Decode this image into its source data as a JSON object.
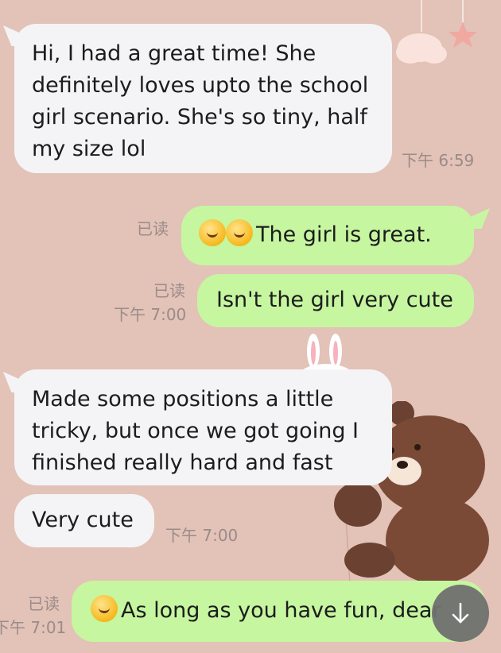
{
  "messages": [
    {
      "text": "Hi, I had a great time! She definitely loves upto the school girl scenario. She's so tiny, half my size lol",
      "time": "下午 6:59"
    },
    {
      "text": "The girl is great.",
      "status": "已读"
    },
    {
      "text": "Isn't the girl very cute",
      "status": "已读",
      "time": "下午 7:00"
    },
    {
      "text": "Made some positions a little tricky, but once we got going I finished really hard and fast"
    },
    {
      "text": "Very cute",
      "time": "下午 7:00"
    },
    {
      "text": "As long as you have fun, dear",
      "status": "已读",
      "time": "下午 7:01"
    }
  ],
  "colors": {
    "background": "#e3c2b8",
    "incoming_bubble": "#f4f4f6",
    "outgoing_bubble": "#c6f6a0"
  },
  "icons": {
    "emoji": "thumbs-up-chick-emoji",
    "scroll": "arrow-down-icon"
  }
}
